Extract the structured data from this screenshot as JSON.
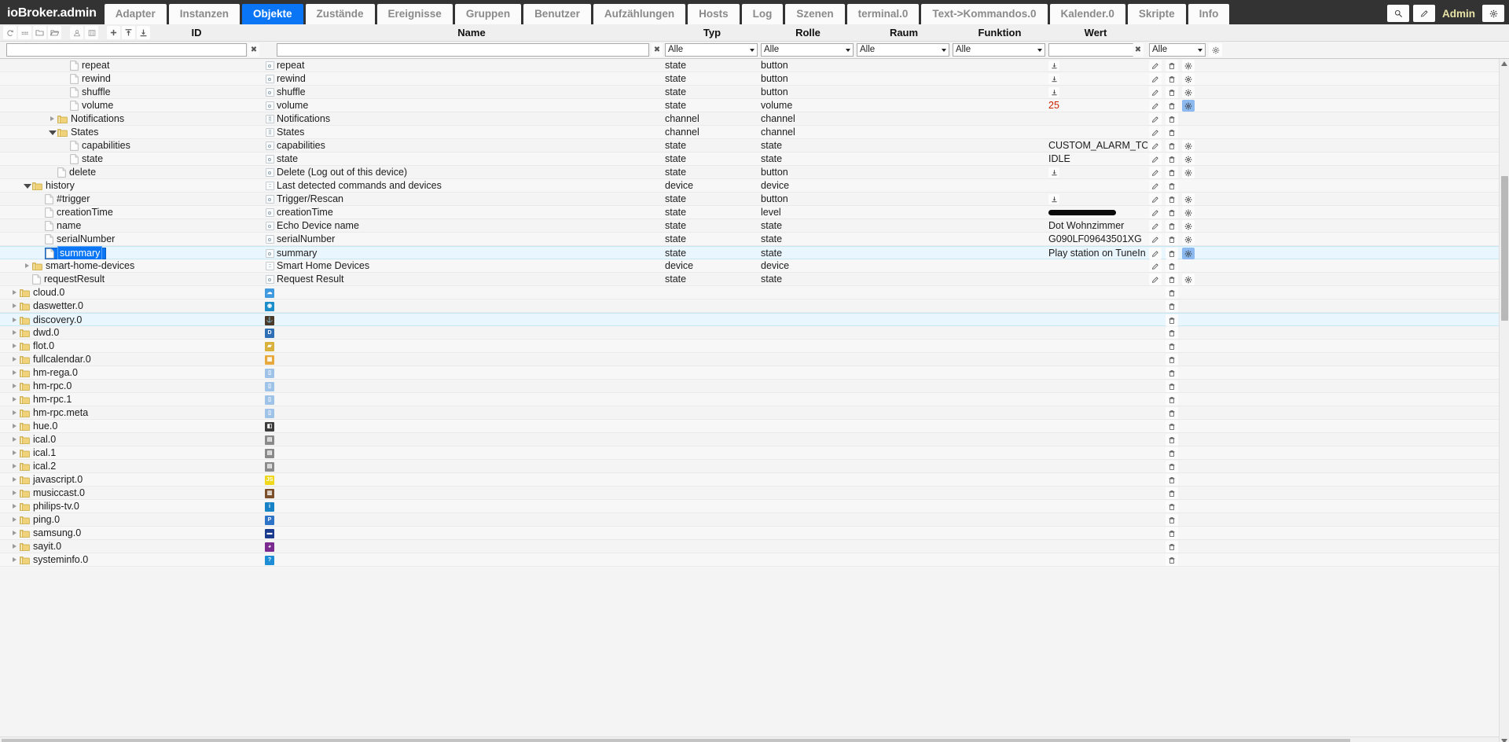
{
  "header": {
    "brand": "ioBroker.admin",
    "tabs": [
      {
        "label": "Adapter",
        "active": false
      },
      {
        "label": "Instanzen",
        "active": false
      },
      {
        "label": "Objekte",
        "active": true
      },
      {
        "label": "Zustände",
        "active": false
      },
      {
        "label": "Ereignisse",
        "active": false
      },
      {
        "label": "Gruppen",
        "active": false
      },
      {
        "label": "Benutzer",
        "active": false
      },
      {
        "label": "Aufzählungen",
        "active": false
      },
      {
        "label": "Hosts",
        "active": false
      },
      {
        "label": "Log",
        "active": false
      },
      {
        "label": "Szenen",
        "active": false
      },
      {
        "label": "terminal.0",
        "active": false
      },
      {
        "label": "Text->Kommandos.0",
        "active": false
      },
      {
        "label": "Kalender.0",
        "active": false
      },
      {
        "label": "Skripte",
        "active": false
      },
      {
        "label": "Info",
        "active": false
      }
    ],
    "right": {
      "search_icon": "search-icon",
      "edit_icon": "pencil-icon",
      "user_label": "Admin",
      "settings_icon": "gear-icon"
    },
    "accent_color": "#0b76f5",
    "brand_bg": "#333333",
    "admin_color": "#e8e3a8"
  },
  "toolbar": {
    "buttons": [
      {
        "name": "refresh-icon",
        "title": "refresh"
      },
      {
        "name": "list-icon",
        "title": "list"
      },
      {
        "name": "folder-closed-icon",
        "title": "collapse all"
      },
      {
        "name": "folder-open-icon",
        "title": "expand all"
      },
      {
        "name": "user-icon",
        "title": "user"
      },
      {
        "name": "columns-icon",
        "title": "columns"
      },
      {
        "name": "plus-icon",
        "title": "add"
      },
      {
        "name": "upload-icon",
        "title": "import"
      },
      {
        "name": "download-icon",
        "title": "export"
      }
    ]
  },
  "columns": [
    {
      "key": "id",
      "label": "ID"
    },
    {
      "key": "name",
      "label": "Name"
    },
    {
      "key": "typ",
      "label": "Typ"
    },
    {
      "key": "rolle",
      "label": "Rolle"
    },
    {
      "key": "raum",
      "label": "Raum"
    },
    {
      "key": "funktion",
      "label": "Funktion"
    },
    {
      "key": "wert",
      "label": "Wert"
    }
  ],
  "filters": {
    "id_value": "",
    "id_placeholder": "",
    "name_value": "",
    "name_placeholder": "",
    "clear_glyph": "✖",
    "typ_value": "Alle",
    "rolle_value": "Alle",
    "raum_value": "Alle",
    "funktion_value": "Alle",
    "wert_value": "",
    "wert_placeholder": "",
    "last_value": "Alle",
    "select_options": [
      "Alle"
    ]
  },
  "rows": [
    {
      "indent": 4,
      "kind": "file",
      "id": "repeat",
      "arrow": "none",
      "icon": "state-icon",
      "name": "repeat",
      "typ": "state",
      "rolle": "button",
      "wert": "",
      "wert_kind": "download",
      "acts": [
        "edit",
        "delete",
        "config"
      ],
      "cfg_on": false,
      "sel": false,
      "hl": false
    },
    {
      "indent": 4,
      "kind": "file",
      "id": "rewind",
      "arrow": "none",
      "icon": "state-icon",
      "name": "rewind",
      "typ": "state",
      "rolle": "button",
      "wert": "",
      "wert_kind": "download",
      "acts": [
        "edit",
        "delete",
        "config"
      ],
      "cfg_on": false,
      "sel": false,
      "hl": false
    },
    {
      "indent": 4,
      "kind": "file",
      "id": "shuffle",
      "arrow": "none",
      "icon": "state-icon",
      "name": "shuffle",
      "typ": "state",
      "rolle": "button",
      "wert": "",
      "wert_kind": "download",
      "acts": [
        "edit",
        "delete",
        "config"
      ],
      "cfg_on": false,
      "sel": false,
      "hl": false
    },
    {
      "indent": 4,
      "kind": "file",
      "id": "volume",
      "arrow": "none",
      "icon": "state-icon",
      "name": "volume",
      "typ": "state",
      "rolle": "volume",
      "wert": "25",
      "wert_kind": "number",
      "acts": [
        "edit",
        "delete",
        "config"
      ],
      "cfg_on": true,
      "sel": false,
      "hl": false
    },
    {
      "indent": 3,
      "kind": "folder",
      "id": "Notifications",
      "arrow": "closed",
      "icon": "channel-icon",
      "name": "Notifications",
      "typ": "channel",
      "rolle": "channel",
      "wert": "",
      "wert_kind": "none",
      "acts": [
        "edit",
        "delete"
      ],
      "cfg_on": false,
      "sel": false,
      "hl": false
    },
    {
      "indent": 3,
      "kind": "folder",
      "id": "States",
      "arrow": "open",
      "icon": "channel-icon",
      "name": "States",
      "typ": "channel",
      "rolle": "channel",
      "wert": "",
      "wert_kind": "none",
      "acts": [
        "edit",
        "delete"
      ],
      "cfg_on": false,
      "sel": false,
      "hl": false
    },
    {
      "indent": 4,
      "kind": "file",
      "id": "capabilities",
      "arrow": "none",
      "icon": "state-icon",
      "name": "capabilities",
      "typ": "state",
      "rolle": "state",
      "wert": "CUSTOM_ALARM_TO",
      "wert_kind": "text",
      "acts": [
        "edit",
        "delete",
        "config"
      ],
      "cfg_on": false,
      "sel": false,
      "hl": false
    },
    {
      "indent": 4,
      "kind": "file",
      "id": "state",
      "arrow": "none",
      "icon": "state-icon",
      "name": "state",
      "typ": "state",
      "rolle": "state",
      "wert": "IDLE",
      "wert_kind": "text",
      "acts": [
        "edit",
        "delete",
        "config"
      ],
      "cfg_on": false,
      "sel": false,
      "hl": false
    },
    {
      "indent": 3,
      "kind": "file",
      "id": "delete",
      "arrow": "none",
      "icon": "state-icon",
      "name": "Delete (Log out of this device)",
      "typ": "state",
      "rolle": "button",
      "wert": "",
      "wert_kind": "download",
      "acts": [
        "edit",
        "delete",
        "config"
      ],
      "cfg_on": false,
      "sel": false,
      "hl": false
    },
    {
      "indent": 1,
      "kind": "folder",
      "id": "history",
      "arrow": "open",
      "icon": "device-icon",
      "name": "Last detected commands and devices",
      "typ": "device",
      "rolle": "device",
      "wert": "",
      "wert_kind": "none",
      "acts": [
        "edit",
        "delete"
      ],
      "cfg_on": false,
      "sel": false,
      "hl": false
    },
    {
      "indent": 2,
      "kind": "file",
      "id": "#trigger",
      "arrow": "none",
      "icon": "state-icon",
      "name": "Trigger/Rescan",
      "typ": "state",
      "rolle": "button",
      "wert": "",
      "wert_kind": "download",
      "acts": [
        "edit",
        "delete",
        "config"
      ],
      "cfg_on": false,
      "sel": false,
      "hl": false
    },
    {
      "indent": 2,
      "kind": "file",
      "id": "creationTime",
      "arrow": "none",
      "icon": "state-icon",
      "name": "creationTime",
      "typ": "state",
      "rolle": "level",
      "wert": "",
      "wert_kind": "redacted",
      "acts": [
        "edit",
        "delete",
        "config"
      ],
      "cfg_on": false,
      "sel": false,
      "hl": false
    },
    {
      "indent": 2,
      "kind": "file",
      "id": "name",
      "arrow": "none",
      "icon": "state-icon",
      "name": "Echo Device name",
      "typ": "state",
      "rolle": "state",
      "wert": "Dot Wohnzimmer",
      "wert_kind": "text",
      "acts": [
        "edit",
        "delete",
        "config"
      ],
      "cfg_on": false,
      "sel": false,
      "hl": false
    },
    {
      "indent": 2,
      "kind": "file",
      "id": "serialNumber",
      "arrow": "none",
      "icon": "state-icon",
      "name": "serialNumber",
      "typ": "state",
      "rolle": "state",
      "wert": "G090LF09643501XG",
      "wert_kind": "text",
      "acts": [
        "edit",
        "delete",
        "config"
      ],
      "cfg_on": false,
      "sel": false,
      "hl": false
    },
    {
      "indent": 2,
      "kind": "file",
      "id": "summary",
      "arrow": "none",
      "icon": "state-icon",
      "name": "summary",
      "typ": "state",
      "rolle": "state",
      "wert": "Play station on TuneIn",
      "wert_kind": "text",
      "acts": [
        "edit",
        "delete",
        "config"
      ],
      "cfg_on": true,
      "sel": true,
      "hl": true
    },
    {
      "indent": 1,
      "kind": "folder",
      "id": "smart-home-devices",
      "arrow": "closed",
      "icon": "device-icon",
      "name": "Smart Home Devices",
      "typ": "device",
      "rolle": "device",
      "wert": "",
      "wert_kind": "none",
      "acts": [
        "edit",
        "delete"
      ],
      "cfg_on": false,
      "sel": false,
      "hl": false
    },
    {
      "indent": 1,
      "kind": "file",
      "id": "requestResult",
      "arrow": "none",
      "icon": "state-icon",
      "name": "Request Result",
      "typ": "state",
      "rolle": "state",
      "wert": "",
      "wert_kind": "none",
      "acts": [
        "edit",
        "delete",
        "config"
      ],
      "cfg_on": false,
      "sel": false,
      "hl": false
    },
    {
      "indent": 0,
      "kind": "folder",
      "id": "cloud.0",
      "arrow": "closed",
      "icon": "adapter-cloud",
      "name": "",
      "typ": "",
      "rolle": "",
      "wert": "",
      "wert_kind": "none",
      "acts": [
        "delete"
      ],
      "cfg_on": false,
      "sel": false,
      "hl": false
    },
    {
      "indent": 0,
      "kind": "folder",
      "id": "daswetter.0",
      "arrow": "closed",
      "icon": "adapter-daswetter",
      "name": "",
      "typ": "",
      "rolle": "",
      "wert": "",
      "wert_kind": "none",
      "acts": [
        "delete"
      ],
      "cfg_on": false,
      "sel": false,
      "hl": false
    },
    {
      "indent": 0,
      "kind": "folder",
      "id": "discovery.0",
      "arrow": "closed",
      "icon": "adapter-discovery",
      "name": "",
      "typ": "",
      "rolle": "",
      "wert": "",
      "wert_kind": "none",
      "acts": [
        "delete"
      ],
      "cfg_on": false,
      "sel": false,
      "hl": true
    },
    {
      "indent": 0,
      "kind": "folder",
      "id": "dwd.0",
      "arrow": "closed",
      "icon": "adapter-dwd",
      "name": "",
      "typ": "",
      "rolle": "",
      "wert": "",
      "wert_kind": "none",
      "acts": [
        "delete"
      ],
      "cfg_on": false,
      "sel": false,
      "hl": false
    },
    {
      "indent": 0,
      "kind": "folder",
      "id": "flot.0",
      "arrow": "closed",
      "icon": "adapter-flot",
      "name": "",
      "typ": "",
      "rolle": "",
      "wert": "",
      "wert_kind": "none",
      "acts": [
        "delete"
      ],
      "cfg_on": false,
      "sel": false,
      "hl": false
    },
    {
      "indent": 0,
      "kind": "folder",
      "id": "fullcalendar.0",
      "arrow": "closed",
      "icon": "adapter-fullcalendar",
      "name": "",
      "typ": "",
      "rolle": "",
      "wert": "",
      "wert_kind": "none",
      "acts": [
        "delete"
      ],
      "cfg_on": false,
      "sel": false,
      "hl": false
    },
    {
      "indent": 0,
      "kind": "folder",
      "id": "hm-rega.0",
      "arrow": "closed",
      "icon": "adapter-hm",
      "name": "",
      "typ": "",
      "rolle": "",
      "wert": "",
      "wert_kind": "none",
      "acts": [
        "delete"
      ],
      "cfg_on": false,
      "sel": false,
      "hl": false
    },
    {
      "indent": 0,
      "kind": "folder",
      "id": "hm-rpc.0",
      "arrow": "closed",
      "icon": "adapter-hm",
      "name": "",
      "typ": "",
      "rolle": "",
      "wert": "",
      "wert_kind": "none",
      "acts": [
        "delete"
      ],
      "cfg_on": false,
      "sel": false,
      "hl": false
    },
    {
      "indent": 0,
      "kind": "folder",
      "id": "hm-rpc.1",
      "arrow": "closed",
      "icon": "adapter-hm",
      "name": "",
      "typ": "",
      "rolle": "",
      "wert": "",
      "wert_kind": "none",
      "acts": [
        "delete"
      ],
      "cfg_on": false,
      "sel": false,
      "hl": false
    },
    {
      "indent": 0,
      "kind": "folder",
      "id": "hm-rpc.meta",
      "arrow": "closed",
      "icon": "adapter-hm",
      "name": "",
      "typ": "",
      "rolle": "",
      "wert": "",
      "wert_kind": "none",
      "acts": [
        "delete"
      ],
      "cfg_on": false,
      "sel": false,
      "hl": false
    },
    {
      "indent": 0,
      "kind": "folder",
      "id": "hue.0",
      "arrow": "closed",
      "icon": "adapter-hue",
      "name": "",
      "typ": "",
      "rolle": "",
      "wert": "",
      "wert_kind": "none",
      "acts": [
        "delete"
      ],
      "cfg_on": false,
      "sel": false,
      "hl": false
    },
    {
      "indent": 0,
      "kind": "folder",
      "id": "ical.0",
      "arrow": "closed",
      "icon": "adapter-ical",
      "name": "",
      "typ": "",
      "rolle": "",
      "wert": "",
      "wert_kind": "none",
      "acts": [
        "delete"
      ],
      "cfg_on": false,
      "sel": false,
      "hl": false
    },
    {
      "indent": 0,
      "kind": "folder",
      "id": "ical.1",
      "arrow": "closed",
      "icon": "adapter-ical",
      "name": "",
      "typ": "",
      "rolle": "",
      "wert": "",
      "wert_kind": "none",
      "acts": [
        "delete"
      ],
      "cfg_on": false,
      "sel": false,
      "hl": false
    },
    {
      "indent": 0,
      "kind": "folder",
      "id": "ical.2",
      "arrow": "closed",
      "icon": "adapter-ical",
      "name": "",
      "typ": "",
      "rolle": "",
      "wert": "",
      "wert_kind": "none",
      "acts": [
        "delete"
      ],
      "cfg_on": false,
      "sel": false,
      "hl": false
    },
    {
      "indent": 0,
      "kind": "folder",
      "id": "javascript.0",
      "arrow": "closed",
      "icon": "adapter-javascript",
      "name": "",
      "typ": "",
      "rolle": "",
      "wert": "",
      "wert_kind": "none",
      "acts": [
        "delete"
      ],
      "cfg_on": false,
      "sel": false,
      "hl": false
    },
    {
      "indent": 0,
      "kind": "folder",
      "id": "musiccast.0",
      "arrow": "closed",
      "icon": "adapter-musiccast",
      "name": "",
      "typ": "",
      "rolle": "",
      "wert": "",
      "wert_kind": "none",
      "acts": [
        "delete"
      ],
      "cfg_on": false,
      "sel": false,
      "hl": false
    },
    {
      "indent": 0,
      "kind": "folder",
      "id": "philips-tv.0",
      "arrow": "closed",
      "icon": "adapter-philips",
      "name": "",
      "typ": "",
      "rolle": "",
      "wert": "",
      "wert_kind": "none",
      "acts": [
        "delete"
      ],
      "cfg_on": false,
      "sel": false,
      "hl": false
    },
    {
      "indent": 0,
      "kind": "folder",
      "id": "ping.0",
      "arrow": "closed",
      "icon": "adapter-ping",
      "name": "",
      "typ": "",
      "rolle": "",
      "wert": "",
      "wert_kind": "none",
      "acts": [
        "delete"
      ],
      "cfg_on": false,
      "sel": false,
      "hl": false
    },
    {
      "indent": 0,
      "kind": "folder",
      "id": "samsung.0",
      "arrow": "closed",
      "icon": "adapter-samsung",
      "name": "",
      "typ": "",
      "rolle": "",
      "wert": "",
      "wert_kind": "none",
      "acts": [
        "delete"
      ],
      "cfg_on": false,
      "sel": false,
      "hl": false
    },
    {
      "indent": 0,
      "kind": "folder",
      "id": "sayit.0",
      "arrow": "closed",
      "icon": "adapter-sayit",
      "name": "",
      "typ": "",
      "rolle": "",
      "wert": "",
      "wert_kind": "none",
      "acts": [
        "delete"
      ],
      "cfg_on": false,
      "sel": false,
      "hl": false
    },
    {
      "indent": 0,
      "kind": "folder",
      "id": "systeminfo.0",
      "arrow": "closed",
      "icon": "adapter-systeminfo",
      "name": "",
      "typ": "",
      "rolle": "",
      "wert": "",
      "wert_kind": "none",
      "acts": [
        "delete"
      ],
      "cfg_on": false,
      "sel": false,
      "hl": false
    }
  ],
  "scrollbars": {
    "vertical_thumb_top_pct": 17,
    "vertical_thumb_height_pct": 21,
    "horizontal_thumb_width_pct": 90,
    "up_arrow_icon": "caret-up-icon",
    "down_arrow_icon": "caret-down-icon"
  }
}
